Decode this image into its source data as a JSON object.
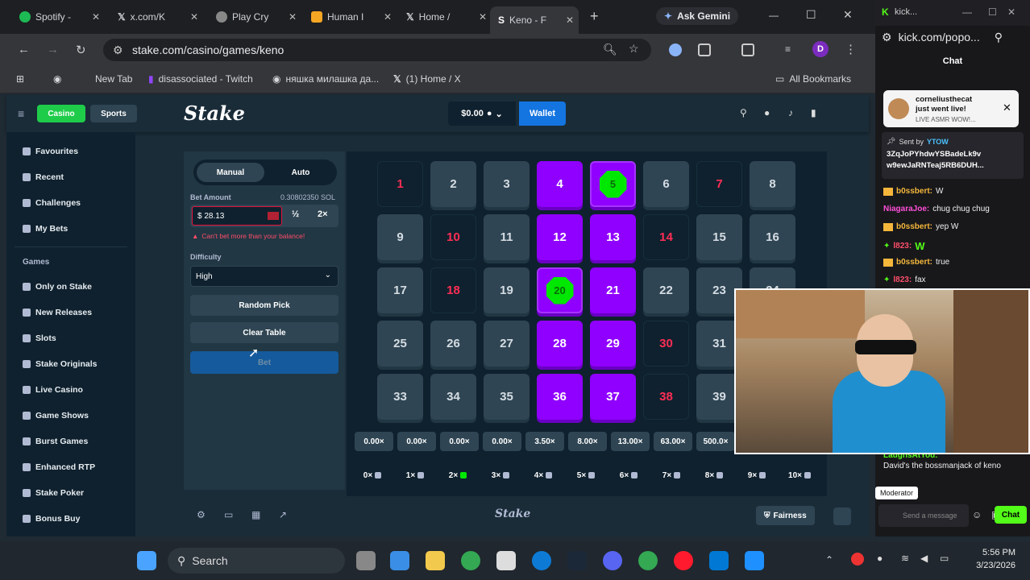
{
  "browser": {
    "tabs": [
      {
        "label": "Spotify -",
        "color": "#1db954"
      },
      {
        "label": "x.com/K",
        "color": "#ffffff"
      },
      {
        "label": "Play Cry",
        "color": "#cccccc"
      },
      {
        "label": "Human I",
        "color": "#f5a623"
      },
      {
        "label": "Home /",
        "color": "#ffffff"
      },
      {
        "label": "Keno - F",
        "color": "#ffffff"
      }
    ],
    "new_tab_symbol": "+",
    "gemini_label": "Ask Gemini",
    "url": "stake.com/casino/games/keno",
    "profile_initial": "D",
    "bookmarks": [
      "New Tab",
      "disassociated - Twitch",
      "няшка милашка да...",
      "(1) Home / X"
    ],
    "all_bookmarks": "All Bookmarks"
  },
  "stake": {
    "casino_tab": "Casino",
    "sports_tab": "Sports",
    "logo": "Stake",
    "balance": "$0.00",
    "wallet": "Wallet",
    "sidebar": {
      "items": [
        "Favourites",
        "Recent",
        "Challenges",
        "My Bets"
      ],
      "section": "Games",
      "games": [
        "Only on Stake",
        "New Releases",
        "Slots",
        "Stake Originals",
        "Live Casino",
        "Game Shows",
        "Burst Games",
        "Enhanced RTP",
        "Stake Poker",
        "Bonus Buy"
      ]
    },
    "panel": {
      "manual": "Manual",
      "auto": "Auto",
      "bet_amount_label": "Bet Amount",
      "bet_amount_sol": "0.30802350 SOL",
      "bet_value": "$ 28.13",
      "half": "½",
      "double": "2×",
      "error": "Can't bet more than your balance!",
      "difficulty_label": "Difficulty",
      "difficulty_value": "High",
      "random_pick": "Random Pick",
      "clear_table": "Clear Table",
      "bet": "Bet"
    },
    "multipliers": [
      "0.00×",
      "0.00×",
      "0.00×",
      "0.00×",
      "3.50×",
      "8.00×",
      "13.00×",
      "63.00×",
      "500.0×"
    ],
    "hits": [
      "0×",
      "1×",
      "2×",
      "3×",
      "4×",
      "5×",
      "6×",
      "7×",
      "8×",
      "9×",
      "10×"
    ],
    "footer_logo": "Stake",
    "fairness": "Fairness"
  },
  "chat": {
    "site": "kick...",
    "url": "kick.com/popo...",
    "title": "Chat",
    "notice_user": "corneliusthecat",
    "notice_text": "just went live!",
    "notice_sub": "LIVE ASMR WOW!...",
    "sent_by": "Sent by",
    "sent_user": "YTOW",
    "pinned_line1": "3ZqJoPYhdwYSBadeLk9v",
    "pinned_line2": "w9ewJaRNTeaj5RB6DUH...",
    "messages": [
      {
        "user": "b0ssbert:",
        "text": "W",
        "color": "#f5b73b"
      },
      {
        "user": "NiagaraJoe:",
        "text": "chug chug chug",
        "color": "#ff4fd8"
      },
      {
        "user": "b0ssbert:",
        "text": "yep W",
        "color": "#f5b73b"
      },
      {
        "user": "l823:",
        "text": "W",
        "color": "#ff4f6a"
      },
      {
        "user": "b0ssbert:",
        "text": "true",
        "color": "#f5b73b"
      },
      {
        "user": "l823:",
        "text": "fax",
        "color": "#ff4f6a"
      }
    ],
    "bottom_user": "LaughsAtYou:",
    "bottom_msg": "David's the bossmanjack of keno",
    "moderator": "Moderator",
    "send_placeholder": "Send a message",
    "chat_button": "Chat"
  },
  "taskbar": {
    "search": "Search",
    "time": "5:56 PM",
    "date": "3/23/2026"
  },
  "board": {
    "picked": [
      4,
      5,
      12,
      13,
      20,
      21,
      28,
      29,
      36,
      37
    ],
    "gems": [
      5,
      20
    ],
    "dark": [
      1,
      7,
      10,
      14,
      18,
      30,
      38
    ]
  }
}
